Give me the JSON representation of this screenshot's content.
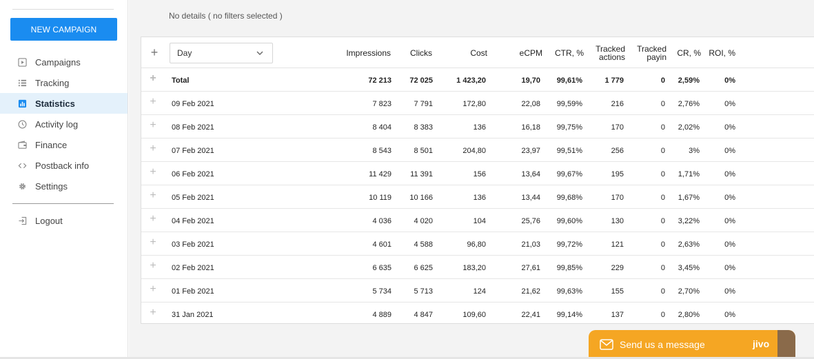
{
  "sidebar": {
    "new_campaign_label": "NEW CAMPAIGN",
    "items": [
      {
        "label": "Campaigns",
        "icon": "play-square-icon",
        "active": false
      },
      {
        "label": "Tracking",
        "icon": "list-icon",
        "active": false
      },
      {
        "label": "Statistics",
        "icon": "bar-chart-icon",
        "active": true
      },
      {
        "label": "Activity log",
        "icon": "clock-icon",
        "active": false
      },
      {
        "label": "Finance",
        "icon": "wallet-icon",
        "active": false
      },
      {
        "label": "Postback info",
        "icon": "code-icon",
        "active": false
      },
      {
        "label": "Settings",
        "icon": "gear-icon",
        "active": false
      }
    ],
    "logout_label": "Logout"
  },
  "main": {
    "details_text": "No details ( no filters selected )",
    "group_by_select": "Day",
    "columns": [
      "Impressions",
      "Clicks",
      "Cost",
      "eCPM",
      "CTR, %",
      "Tracked actions",
      "Tracked payin",
      "CR, %",
      "ROI, %"
    ],
    "rows": [
      {
        "date": "Total",
        "impressions": "72 213",
        "clicks": "72 025",
        "cost": "1 423,20",
        "ecpm": "19,70",
        "ctr": "99,61%",
        "tracked_actions": "1 779",
        "tracked_payin": "0",
        "cr": "2,59%",
        "roi": "0%"
      },
      {
        "date": "09 Feb 2021",
        "impressions": "7 823",
        "clicks": "7 791",
        "cost": "172,80",
        "ecpm": "22,08",
        "ctr": "99,59%",
        "tracked_actions": "216",
        "tracked_payin": "0",
        "cr": "2,76%",
        "roi": "0%"
      },
      {
        "date": "08 Feb 2021",
        "impressions": "8 404",
        "clicks": "8 383",
        "cost": "136",
        "ecpm": "16,18",
        "ctr": "99,75%",
        "tracked_actions": "170",
        "tracked_payin": "0",
        "cr": "2,02%",
        "roi": "0%"
      },
      {
        "date": "07 Feb 2021",
        "impressions": "8 543",
        "clicks": "8 501",
        "cost": "204,80",
        "ecpm": "23,97",
        "ctr": "99,51%",
        "tracked_actions": "256",
        "tracked_payin": "0",
        "cr": "3%",
        "roi": "0%"
      },
      {
        "date": "06 Feb 2021",
        "impressions": "11 429",
        "clicks": "11 391",
        "cost": "156",
        "ecpm": "13,64",
        "ctr": "99,67%",
        "tracked_actions": "195",
        "tracked_payin": "0",
        "cr": "1,71%",
        "roi": "0%"
      },
      {
        "date": "05 Feb 2021",
        "impressions": "10 119",
        "clicks": "10 166",
        "cost": "136",
        "ecpm": "13,44",
        "ctr": "99,68%",
        "tracked_actions": "170",
        "tracked_payin": "0",
        "cr": "1,67%",
        "roi": "0%"
      },
      {
        "date": "04 Feb 2021",
        "impressions": "4 036",
        "clicks": "4 020",
        "cost": "104",
        "ecpm": "25,76",
        "ctr": "99,60%",
        "tracked_actions": "130",
        "tracked_payin": "0",
        "cr": "3,22%",
        "roi": "0%"
      },
      {
        "date": "03 Feb 2021",
        "impressions": "4 601",
        "clicks": "4 588",
        "cost": "96,80",
        "ecpm": "21,03",
        "ctr": "99,72%",
        "tracked_actions": "121",
        "tracked_payin": "0",
        "cr": "2,63%",
        "roi": "0%"
      },
      {
        "date": "02 Feb 2021",
        "impressions": "6 635",
        "clicks": "6 625",
        "cost": "183,20",
        "ecpm": "27,61",
        "ctr": "99,85%",
        "tracked_actions": "229",
        "tracked_payin": "0",
        "cr": "3,45%",
        "roi": "0%"
      },
      {
        "date": "01 Feb 2021",
        "impressions": "5 734",
        "clicks": "5 713",
        "cost": "124",
        "ecpm": "21,62",
        "ctr": "99,63%",
        "tracked_actions": "155",
        "tracked_payin": "0",
        "cr": "2,70%",
        "roi": "0%"
      },
      {
        "date": "31 Jan 2021",
        "impressions": "4 889",
        "clicks": "4 847",
        "cost": "109,60",
        "ecpm": "22,41",
        "ctr": "99,14%",
        "tracked_actions": "137",
        "tracked_payin": "0",
        "cr": "2,80%",
        "roi": "0%"
      }
    ]
  },
  "chat": {
    "label": "Send us a message",
    "brand": "jivo",
    "color": "#f5a623"
  },
  "colors": {
    "accent": "#1a8cf0",
    "active_nav_bg": "#e4f1fb"
  }
}
